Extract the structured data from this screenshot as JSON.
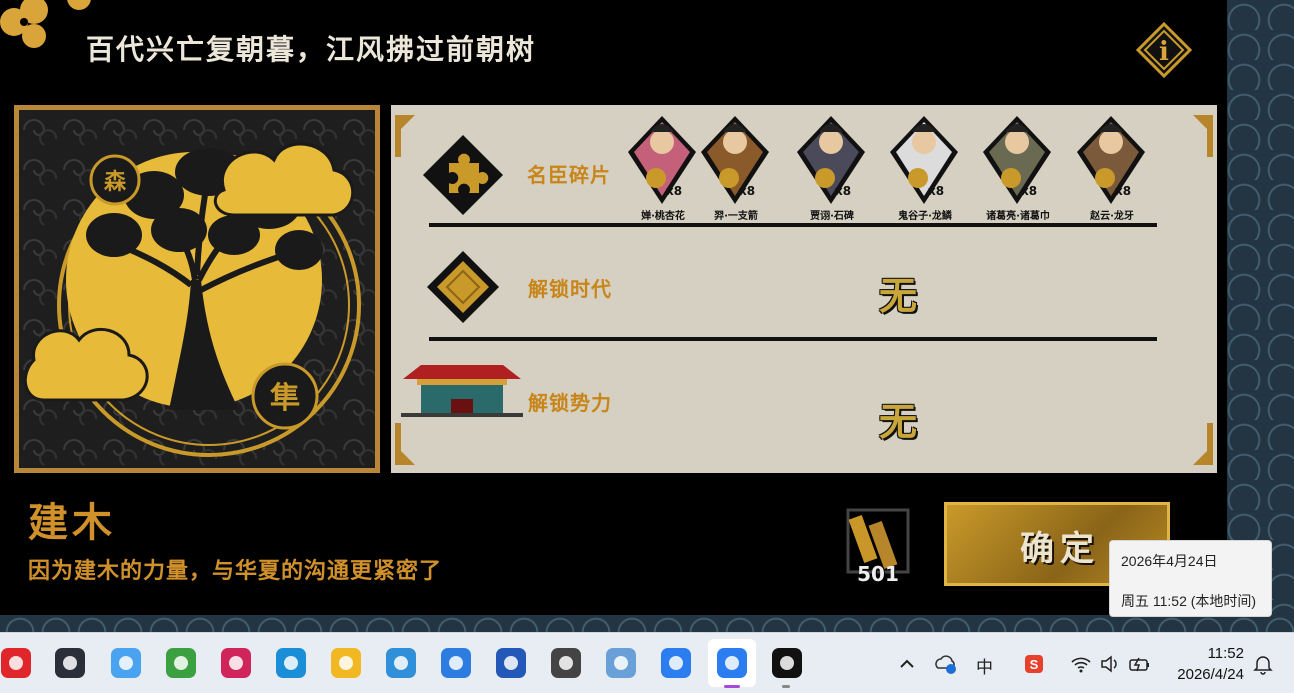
{
  "game": {
    "title": "百代兴亡复朝暮，江风拂过前朝树",
    "info_glyph": "i",
    "emblem_glyphs": [
      "森",
      "隼"
    ],
    "rows": {
      "fragments_label": "名臣碎片",
      "era_label": "解锁时代",
      "faction_label": "解锁势力",
      "era_value": "无",
      "faction_value": "无"
    },
    "heroes": [
      {
        "name": "婵·桃杏花",
        "count": "x8",
        "color": "#c4607a"
      },
      {
        "name": "羿·一支箭",
        "count": "x8",
        "color": "#8a5a2a"
      },
      {
        "name": "贾诩·石碑",
        "count": "x8",
        "color": "#4a4a5a"
      },
      {
        "name": "鬼谷子·龙鳞",
        "count": "x8",
        "color": "#dcdcdc"
      },
      {
        "name": "诸葛亮·诸葛巾",
        "count": "x8",
        "color": "#6a6a52"
      },
      {
        "name": "赵云·龙牙",
        "count": "x8",
        "color": "#7a5a3a"
      }
    ],
    "building_name": "建木",
    "description": "因为建木的力量，与华夏的沟通更紧密了",
    "resource_count": "501",
    "confirm_label": "确定"
  },
  "tooltip": {
    "date": "2026年4月24日",
    "time": "周五 11:52 (本地时间)"
  },
  "taskbar": {
    "apps": [
      {
        "name": "netease-music-icon",
        "color": "#e0262b"
      },
      {
        "name": "steam-icon",
        "color": "#2a2f3a"
      },
      {
        "name": "photos-icon",
        "color": "#4aa3f0"
      },
      {
        "name": "game-icon",
        "color": "#3aa040"
      },
      {
        "name": "app-wifi-icon",
        "color": "#d0255a"
      },
      {
        "name": "edge-icon",
        "color": "#1a8fd8"
      },
      {
        "name": "file-explorer-icon",
        "color": "#f2b823"
      },
      {
        "name": "notepad-icon",
        "color": "#2f8fd8"
      },
      {
        "name": "cloud-drive-icon",
        "color": "#2d7de0"
      },
      {
        "name": "game-center-icon",
        "color": "#2458b8"
      },
      {
        "name": "chat-bubble-icon",
        "color": "#444444"
      },
      {
        "name": "anime-avatar-icon",
        "color": "#6aa0d8"
      },
      {
        "name": "meitu-icon",
        "color": "#2c7df0"
      },
      {
        "name": "active-app-icon",
        "color": "#2c7df0"
      },
      {
        "name": "qq-icon",
        "color": "#111111"
      }
    ],
    "ime_label": "中",
    "clock_time": "11:52",
    "clock_date": "2026/4/24"
  }
}
